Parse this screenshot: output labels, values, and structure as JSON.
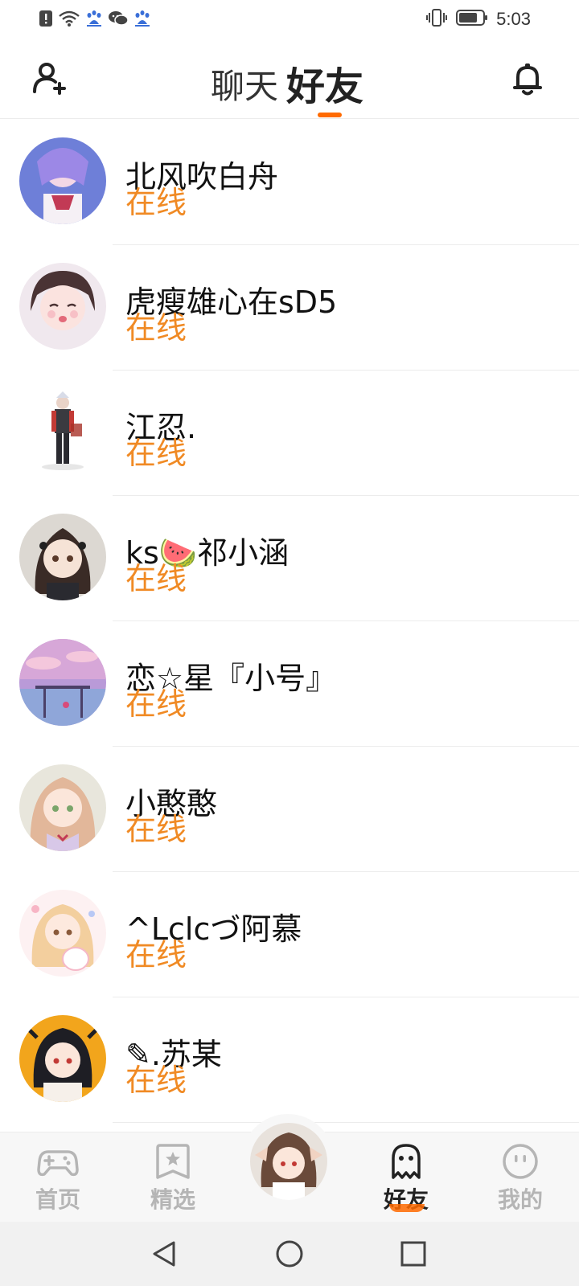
{
  "status_bar": {
    "time": "5:03",
    "icons": [
      "alert-icon",
      "wifi-icon",
      "baidu-icon",
      "wechat-icon",
      "baidu-icon",
      "vibrate-icon",
      "battery-icon"
    ]
  },
  "header": {
    "tabs": [
      {
        "label": "聊天",
        "active": false
      },
      {
        "label": "好友",
        "active": true
      }
    ],
    "accent_color": "#ff6a00"
  },
  "friends": [
    {
      "name": "北风吹白舟",
      "status": "在线"
    },
    {
      "name": "虎瘦雄心在sD5",
      "status": "在线"
    },
    {
      "name": "江忍.",
      "status": "在线"
    },
    {
      "name": "ks🍉祁小涵",
      "status": "在线"
    },
    {
      "name": "恋☆星『小号』",
      "status": "在线"
    },
    {
      "name": "小憨憨",
      "status": "在线"
    },
    {
      "name": "^Lclcづ阿慕",
      "status": "在线"
    },
    {
      "name": "✎.苏某",
      "status": "在线"
    }
  ],
  "status_color": "#f08a24",
  "bottom_nav": {
    "items": [
      {
        "label": "首页",
        "icon": "gamepad-icon",
        "active": false
      },
      {
        "label": "精选",
        "icon": "star-bookmark-icon",
        "active": false
      },
      {
        "label": "好友",
        "icon": "ghost-icon",
        "active": true
      },
      {
        "label": "我的",
        "icon": "smiley-icon",
        "active": false
      }
    ],
    "center_icon": "profile-avatar"
  },
  "system_nav": {
    "icons": [
      "back-icon",
      "home-icon",
      "recent-apps-icon"
    ]
  }
}
